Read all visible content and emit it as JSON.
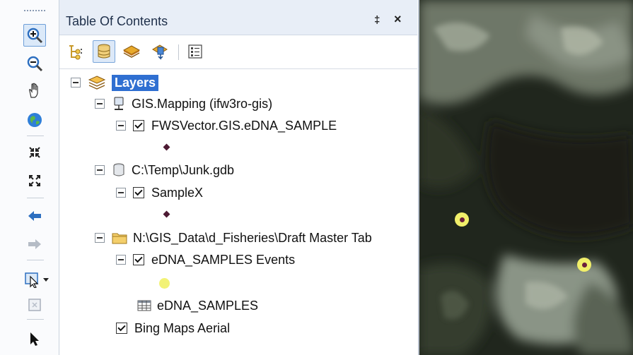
{
  "toc": {
    "title": "Table Of Contents",
    "pin_label": "‡",
    "close_label": "×"
  },
  "toc_toolbar": [
    {
      "name": "list-by-drawing-order",
      "icon": "drawing-order-icon"
    },
    {
      "name": "list-by-source",
      "icon": "source-icon",
      "active": true
    },
    {
      "name": "list-by-visibility",
      "icon": "visibility-icon"
    },
    {
      "name": "list-by-selection",
      "icon": "selection-icon"
    },
    {
      "name": "options",
      "icon": "options-icon"
    }
  ],
  "tree": {
    "layers_label": "Layers",
    "source1_label": "GIS.Mapping (ifw3ro-gis)",
    "layer1_label": "FWSVector.GIS.eDNA_SAMPLE",
    "source2_label": "C:\\Temp\\Junk.gdb",
    "layer2_label": "SampleX",
    "source3_label": "N:\\GIS_Data\\d_Fisheries\\Draft Master Tab",
    "layer3_label": "eDNA_SAMPLES Events",
    "table_label": "eDNA_SAMPLES",
    "basemap_label": "Bing Maps Aerial"
  },
  "tools": [
    "zoom-in-icon",
    "zoom-out-icon",
    "pan-icon",
    "full-extent-icon",
    "fixed-zoom-in-icon",
    "fixed-zoom-out-icon",
    "back-extent-icon",
    "forward-extent-icon",
    "select-features-icon",
    "clear-selection-icon",
    "select-elements-icon"
  ],
  "colors": {
    "selection": "#2f6fd1",
    "point_fill": "#f1ef6a",
    "point_center": "#6b1e3c",
    "diamond": "#4d1a33"
  }
}
